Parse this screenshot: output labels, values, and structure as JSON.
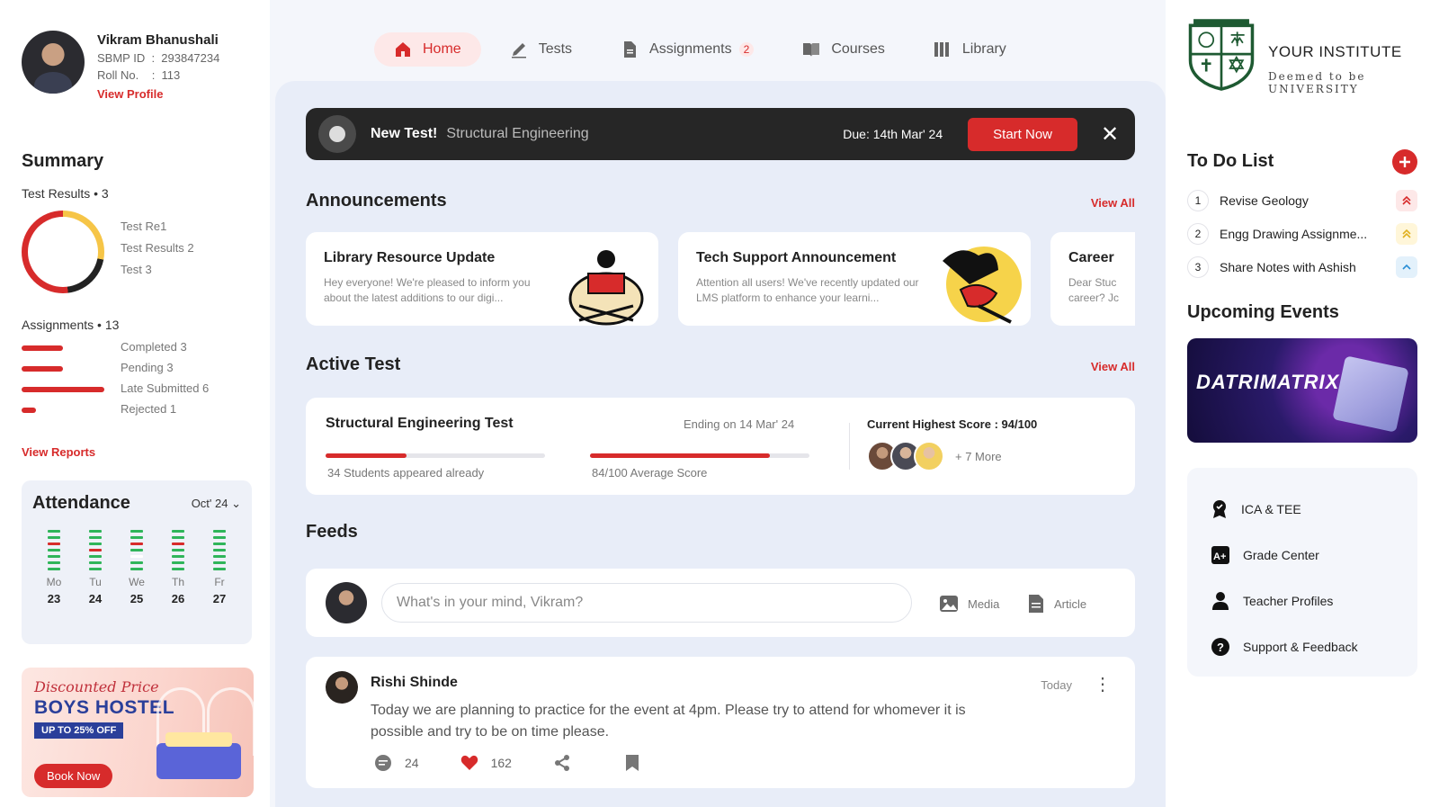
{
  "profile": {
    "name": "Vikram Bhanushali",
    "sbmp_label": "SBMP ID",
    "sbmp_id": "293847234",
    "roll_label": "Roll No.",
    "roll_no": "113",
    "view_profile": "View Profile"
  },
  "summary": {
    "title": "Summary",
    "test_results_label": "Test Results",
    "test_results_count": "• 3",
    "test_results": [
      "Test Re1",
      "Test Results 2",
      "Test 3"
    ],
    "assignments_label": "Assignments",
    "assignments_count": "• 13",
    "assignments": [
      {
        "label": "Completed 3",
        "fraction": 0.23
      },
      {
        "label": "Pending 3",
        "fraction": 0.23
      },
      {
        "label": "Late Submitted 6",
        "fraction": 0.46
      },
      {
        "label": "Rejected 1",
        "fraction": 0.08
      }
    ],
    "view_reports": "View Reports"
  },
  "attendance": {
    "title": "Attendance",
    "month": "Oct' 24",
    "days": [
      {
        "name": "Mo",
        "num": "23"
      },
      {
        "name": "Tu",
        "num": "24"
      },
      {
        "name": "We",
        "num": "25"
      },
      {
        "name": "Th",
        "num": "26"
      },
      {
        "name": "Fr",
        "num": "27"
      }
    ]
  },
  "hostel_ad": {
    "script": "Discounted Price",
    "title": "BOYS HOSTEL",
    "offer": "UP TO 25% OFF",
    "button": "Book Now"
  },
  "nav": {
    "home": "Home",
    "tests": "Tests",
    "assignments": "Assignments",
    "assignments_badge": "2",
    "courses": "Courses",
    "library": "Library"
  },
  "banner": {
    "new_label": "New Test!",
    "subject": "Structural Engineering",
    "due": "Due: 14th Mar' 24",
    "start": "Start Now",
    "close": "✕"
  },
  "announcements": {
    "title": "Announcements",
    "view_all": "View All",
    "items": [
      {
        "title": "Library Resource Update",
        "body": "Hey everyone! We're pleased to inform you about the latest additions to our digi..."
      },
      {
        "title": "Tech Support Announcement",
        "body": "Attention all users! We've recently updated our LMS platform to enhance your learni..."
      },
      {
        "title": "Career",
        "body": "Dear Stuc career? Jc"
      }
    ]
  },
  "active_test": {
    "title": "Active Test",
    "view_all": "View All",
    "name": "Structural Engineering Test",
    "ending": "Ending on 14 Mar' 24",
    "appeared_caption": "34 Students appeared already",
    "appeared_fraction": 0.37,
    "average_caption": "84/100 Average Score",
    "average_fraction": 0.82,
    "highest": "Current Highest Score : 94/100",
    "more": "+ 7 More"
  },
  "feeds": {
    "title": "Feeds",
    "placeholder": "What's in your mind, Vikram?",
    "media": "Media",
    "article": "Article",
    "post": {
      "author": "Rishi Shinde",
      "time": "Today",
      "text": "Today we are planning to practice for the event at 4pm. Please try to attend for whomever it is possible and try to be on time please.",
      "comments": "24",
      "likes": "162"
    }
  },
  "institute": {
    "name": "YOUR INSTITUTE",
    "sub": "Deemed to be UNIVERSITY"
  },
  "todo": {
    "title": "To Do List",
    "items": [
      {
        "num": "1",
        "text": "Revise Geology",
        "priority": "high"
      },
      {
        "num": "2",
        "text": "Engg Drawing Assignme...",
        "priority": "medium"
      },
      {
        "num": "3",
        "text": "Share Notes with Ashish",
        "priority": "low"
      }
    ]
  },
  "events": {
    "title": "Upcoming Events",
    "banner_text": "DATRIMATRIX"
  },
  "quick_links": [
    "ICA & TEE",
    "Grade Center",
    "Teacher Profiles",
    "Support & Feedback"
  ],
  "colors": {
    "accent": "#d72b2b",
    "present": "#2fb55a",
    "dark": "#262626",
    "panel": "#e8edf8"
  }
}
